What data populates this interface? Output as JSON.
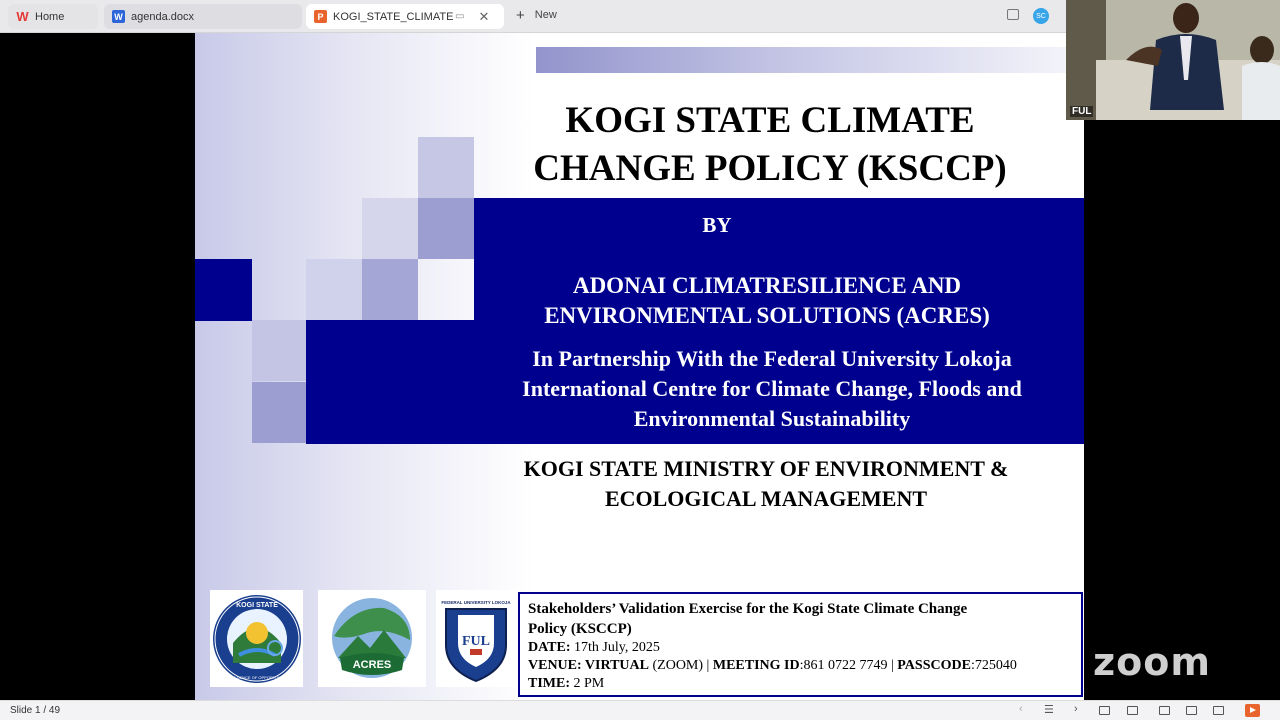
{
  "tabs": {
    "home": "Home",
    "doc": "agenda.docx",
    "active": "KOGI_STATE_CLIMATE_CHAN",
    "new": "New"
  },
  "profile": {
    "initials": "SC"
  },
  "slide": {
    "title_line1": "KOGI STATE CLIMATE",
    "title_line2": "CHANGE POLICY (KSCCP)",
    "by": "BY",
    "org_line1": "ADONAI CLIMATRESILIENCE AND",
    "org_line2": "ENVIRONMENTAL SOLUTIONS (ACRES)",
    "partner_line1": "In Partnership With the Federal University Lokoja",
    "partner_line2": "International Centre for Climate Change, Floods and",
    "partner_line3": "Environmental Sustainability",
    "ministry_line1": "KOGI STATE MINISTRY OF ENVIRONMENT &",
    "ministry_line2": "ECOLOGICAL MANAGEMENT",
    "logos": {
      "kogi_top": "KOGI STATE",
      "kogi_bottom": "CONFLUENCE OF OPPORTUNITIES",
      "acres": "ACRES",
      "ful_top": "FEDERAL UNIVERSITY LOKOJA",
      "ful_letters": "FUL"
    },
    "info": {
      "heading_line1": "Stakeholders’ Validation Exercise for the Kogi State Climate Change",
      "heading_line2": "Policy (KSCCP)",
      "date_label": "DATE:",
      "date_value": " 17th July, 2025",
      "venue_label": "VENUE: VIRTUAL",
      "venue_value": " (ZOOM) | ",
      "meeting_label": "MEETING ID",
      "meeting_value": ":861 0722 7749 | ",
      "passcode_label": "PASSCODE",
      "passcode_value": ":725040",
      "time_label": "TIME:",
      "time_value": " 2 PM"
    }
  },
  "zoom": {
    "participant": "FUL",
    "logo": "zoom"
  },
  "status": {
    "slide_counter": "Slide 1 / 49"
  },
  "colors": {
    "navy": "#00008f",
    "accent": "#e8642c"
  }
}
